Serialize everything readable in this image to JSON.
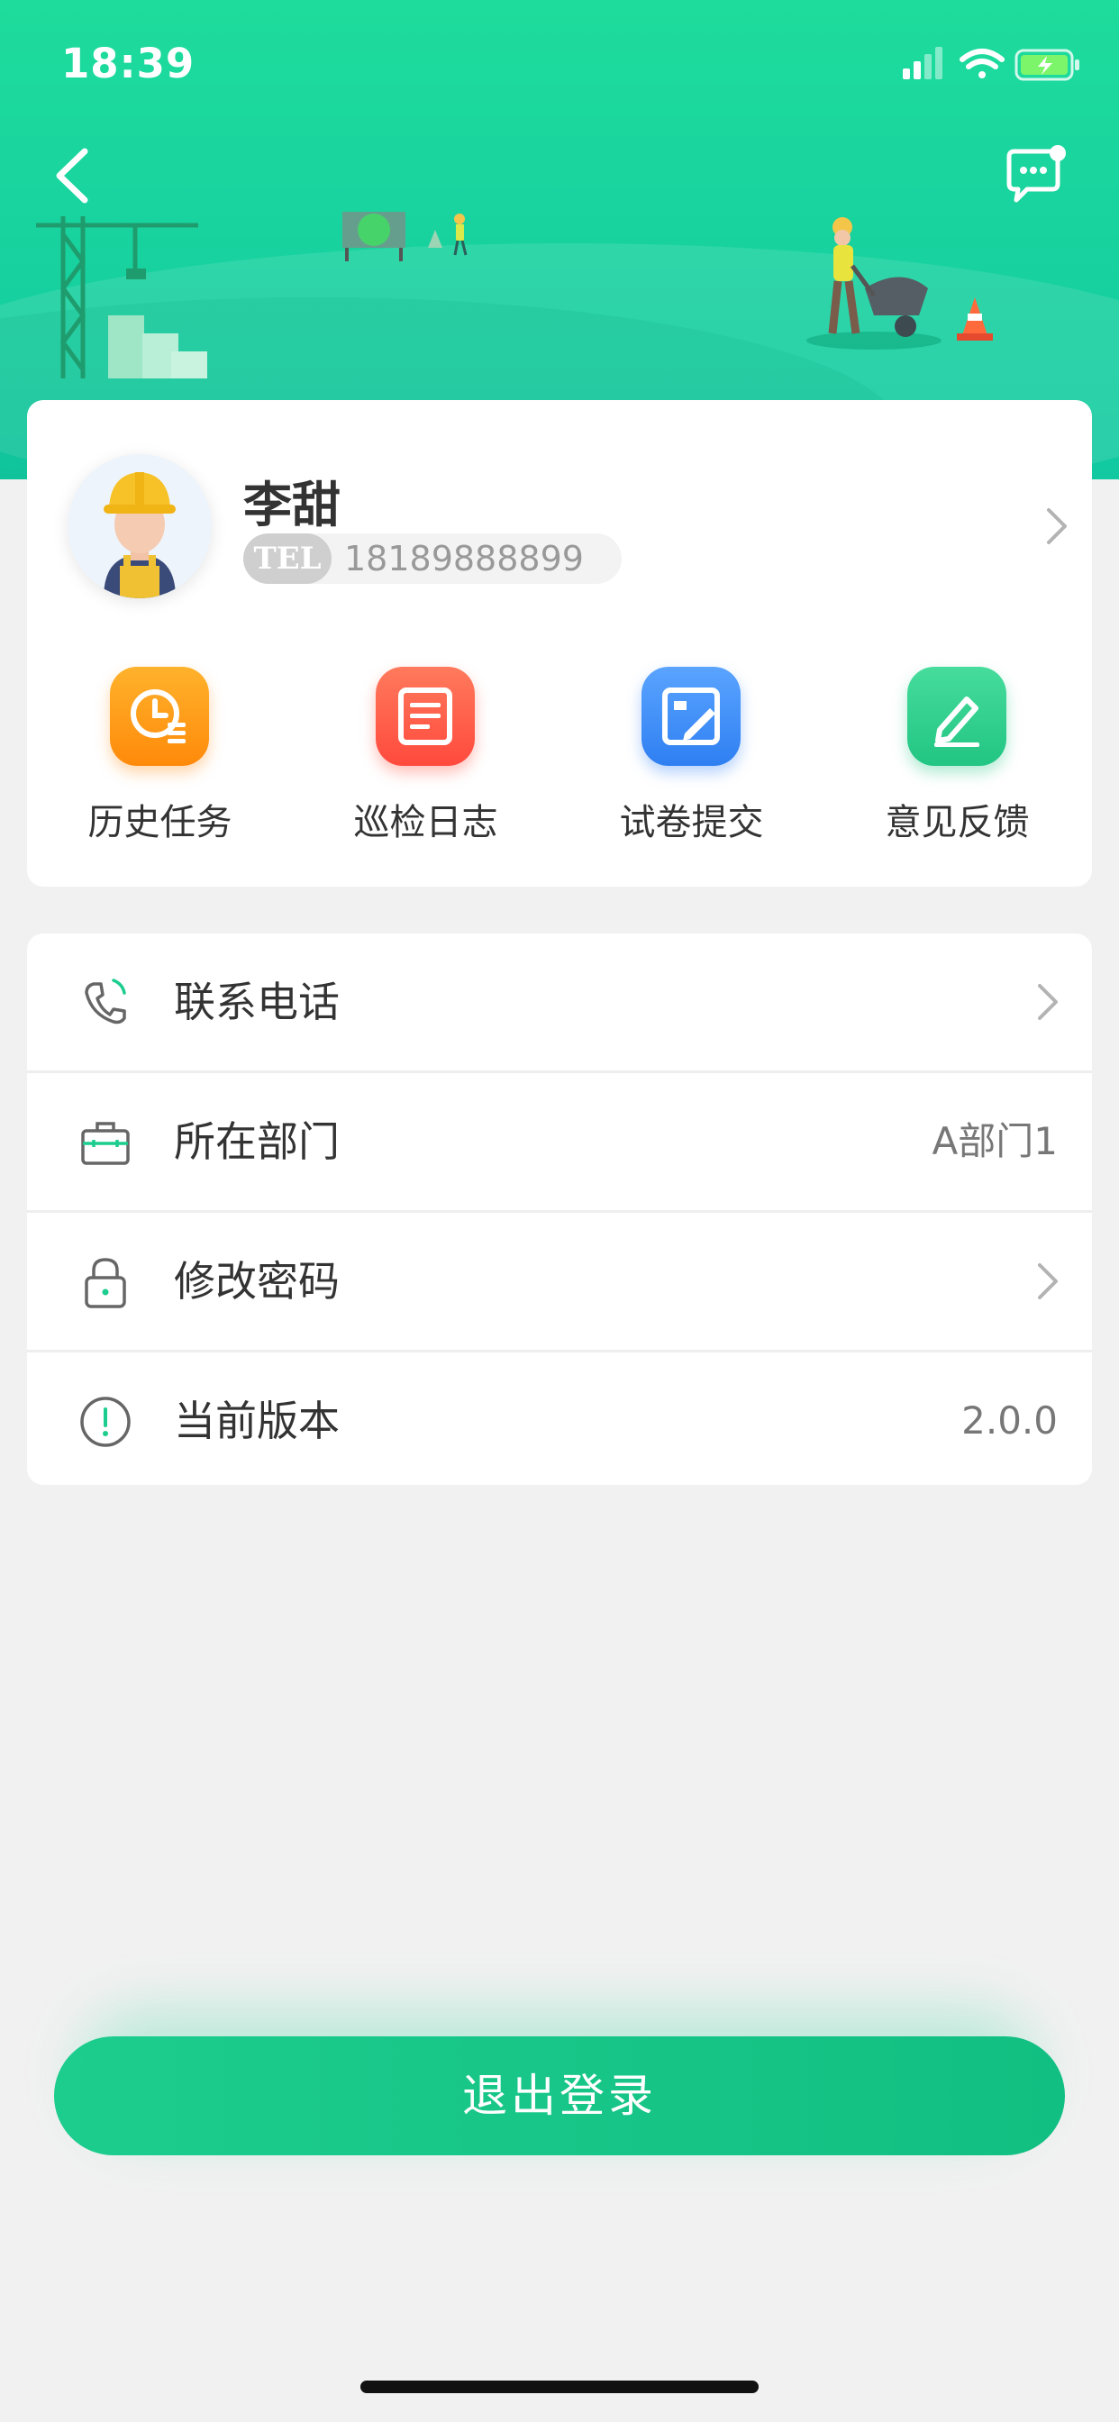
{
  "status_bar": {
    "time": "18:39"
  },
  "profile": {
    "name": "李甜",
    "tel_badge": "TEL",
    "phone": "18189888899"
  },
  "quick_actions": [
    {
      "label": "历史任务",
      "icon": "history-task-icon",
      "color": "#ff9812"
    },
    {
      "label": "巡检日志",
      "icon": "inspection-log-icon",
      "color": "#ff5a4a"
    },
    {
      "label": "试卷提交",
      "icon": "exam-submit-icon",
      "color": "#3f8ff8"
    },
    {
      "label": "意见反馈",
      "icon": "feedback-icon",
      "color": "#2fcf8c"
    }
  ],
  "menu": [
    {
      "label": "联系电话",
      "icon": "phone-icon",
      "value": ""
    },
    {
      "label": "所在部门",
      "icon": "briefcase-icon",
      "value": "A部门1"
    },
    {
      "label": "修改密码",
      "icon": "lock-icon",
      "value": ""
    },
    {
      "label": "当前版本",
      "icon": "info-icon",
      "value": "2.0.0"
    }
  ],
  "logout_label": "退出登录",
  "colors": {
    "accent": "#1ccd8d",
    "header_top": "#1edc9c",
    "background": "#f1f1f1"
  }
}
